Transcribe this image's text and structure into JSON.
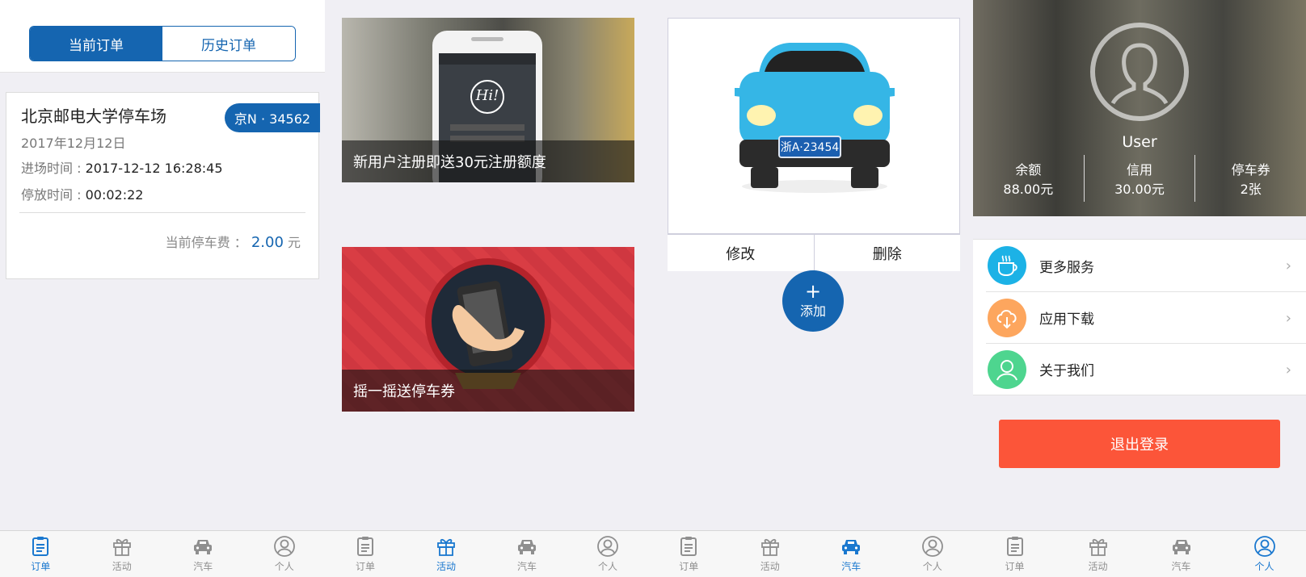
{
  "orders": {
    "tabs": [
      "当前订单",
      "历史订单"
    ],
    "card": {
      "lot_name": "北京邮电大学停车场",
      "plate": "京N · 34562",
      "date": "2017年12月12日",
      "entry_label": "进场时间 : ",
      "entry_value": "2017-12-12 16:28:45",
      "duration_label": "停放时间 : ",
      "duration_value": "00:02:22",
      "fee_label": "当前停车费 ：",
      "fee_value": "2.00",
      "fee_unit": "元"
    }
  },
  "activities": {
    "items": [
      {
        "caption": "新用户注册即送30元注册额度",
        "phone_text": "Hi!"
      },
      {
        "caption": "摇一摇送停车券"
      }
    ]
  },
  "car": {
    "plate": "浙A·23454",
    "edit_label": "修改",
    "delete_label": "删除",
    "add_plus": "+",
    "add_label": "添加"
  },
  "profile": {
    "username": "User",
    "stats": [
      {
        "label": "余额",
        "value": "88.00元"
      },
      {
        "label": "信用",
        "value": "30.00元"
      },
      {
        "label": "停车券",
        "value": "2张"
      }
    ],
    "menu": [
      {
        "label": "更多服务",
        "icon": "cup-icon",
        "color": "#1cb2e6"
      },
      {
        "label": "应用下载",
        "icon": "cloud-download-icon",
        "color": "#fda65e"
      },
      {
        "label": "关于我们",
        "icon": "person-icon",
        "color": "#4ed58f"
      }
    ],
    "logout_label": "退出登录"
  },
  "tabbar": {
    "labels": [
      "订单",
      "活动",
      "汽车",
      "个人"
    ]
  },
  "colors": {
    "primary": "#1565b0",
    "active_tab": "#1a78cf",
    "logout": "#fc5539"
  }
}
